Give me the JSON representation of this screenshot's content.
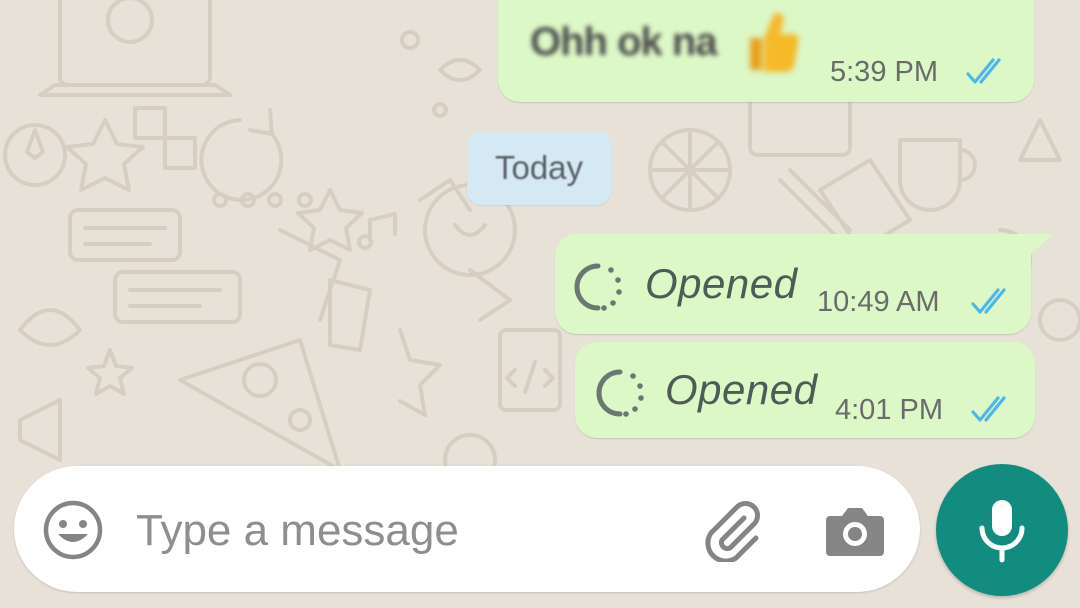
{
  "messages": [
    {
      "text": "Ohh ok na",
      "time": "5:39 PM",
      "status": "read"
    },
    {
      "text": "Opened",
      "time": "10:49 AM",
      "status": "read"
    },
    {
      "text": "Opened",
      "time": "4:01 PM",
      "status": "read"
    }
  ],
  "date_separator": "Today",
  "composer": {
    "placeholder": "Type a message",
    "emoji_icon": "emoji-icon",
    "attach_icon": "paperclip-icon",
    "camera_icon": "camera-icon",
    "mic_icon": "microphone-icon"
  },
  "colors": {
    "outgoing_bubble": "#dcf8c6",
    "date_chip": "#d5e9f5",
    "read_tick": "#4fb6ec",
    "mic_button": "#128c7e",
    "wallpaper": "#e8e1d8"
  }
}
